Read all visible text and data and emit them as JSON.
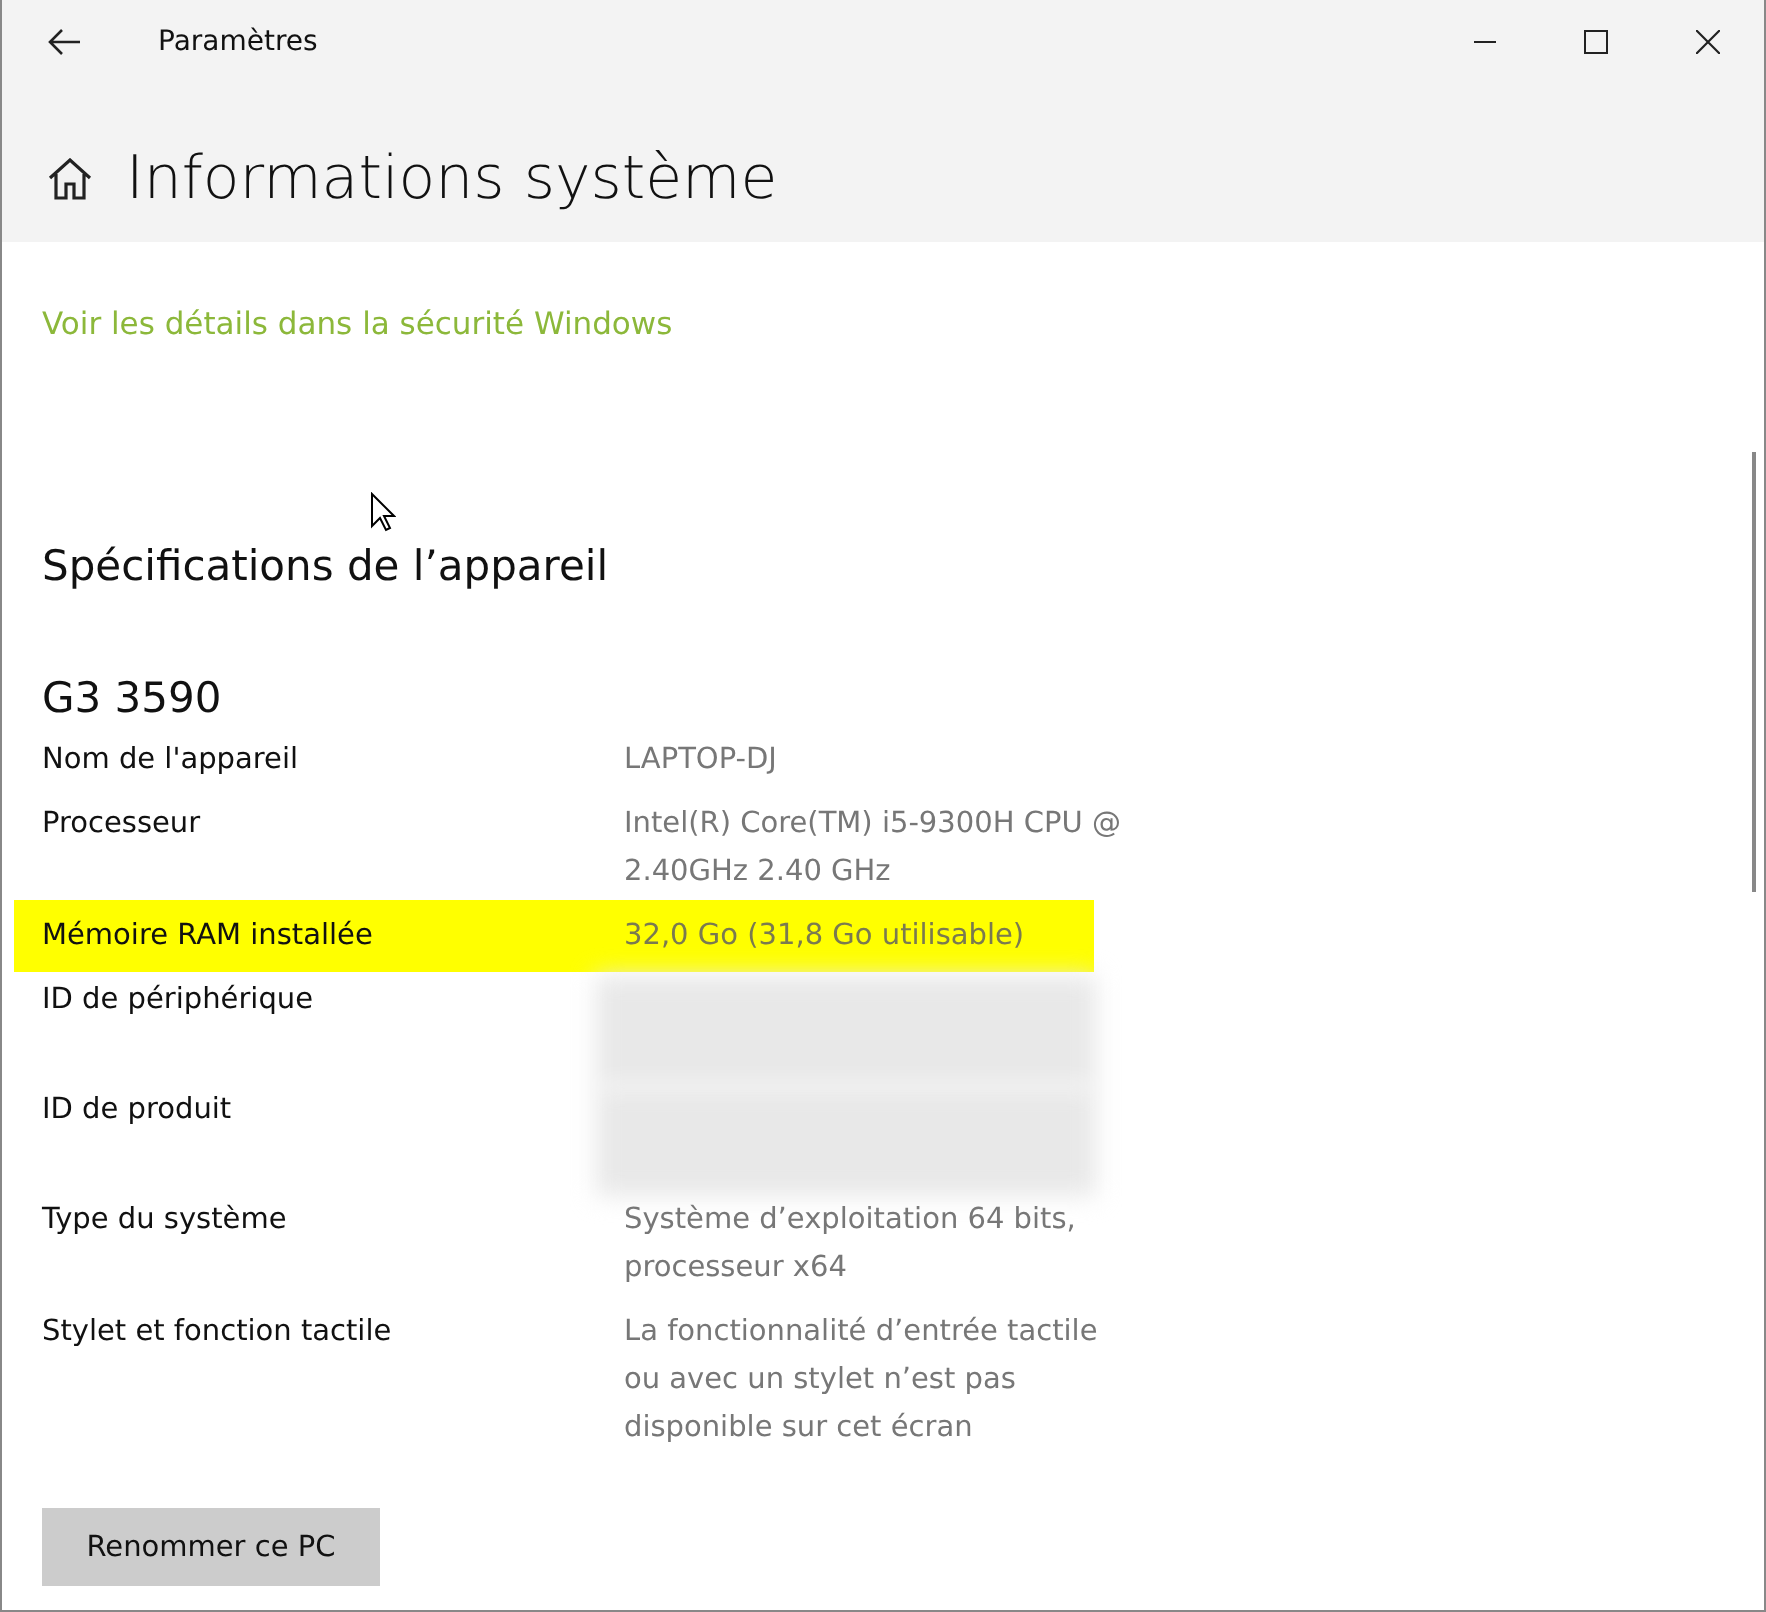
{
  "window": {
    "title": "Paramètres"
  },
  "page_title": "Informations système",
  "security_link": "Voir les détails dans la sécurité Windows",
  "section_title": "Spécifications de l’appareil",
  "device_model": "G3 3590",
  "specs": [
    {
      "label": "Nom de l'appareil",
      "value_lines": [
        "LAPTOP-DJ"
      ],
      "highlighted": false,
      "redacted": false
    },
    {
      "label": "Processeur",
      "value_lines": [
        "Intel(R) Core(TM) i5-9300H CPU @",
        "2.40GHz   2.40 GHz"
      ],
      "highlighted": false,
      "redacted": false
    },
    {
      "label": "Mémoire RAM installée",
      "value_lines": [
        "32,0 Go (31,8 Go utilisable)"
      ],
      "highlighted": true,
      "redacted": false
    },
    {
      "label": "ID de périphérique",
      "highlighted": false,
      "redacted": true
    },
    {
      "label": "ID de produit",
      "highlighted": false,
      "redacted": true
    },
    {
      "label": "Type du système",
      "value_lines": [
        "Système d’exploitation 64 bits,",
        "processeur x64"
      ],
      "highlighted": false,
      "redacted": false
    },
    {
      "label": "Stylet et fonction tactile",
      "value_lines": [
        "La fonctionnalité d’entrée tactile",
        "ou avec un stylet n’est pas",
        "disponible sur cet écran"
      ],
      "highlighted": false,
      "redacted": false
    }
  ],
  "rename_button": "Renommer ce PC"
}
